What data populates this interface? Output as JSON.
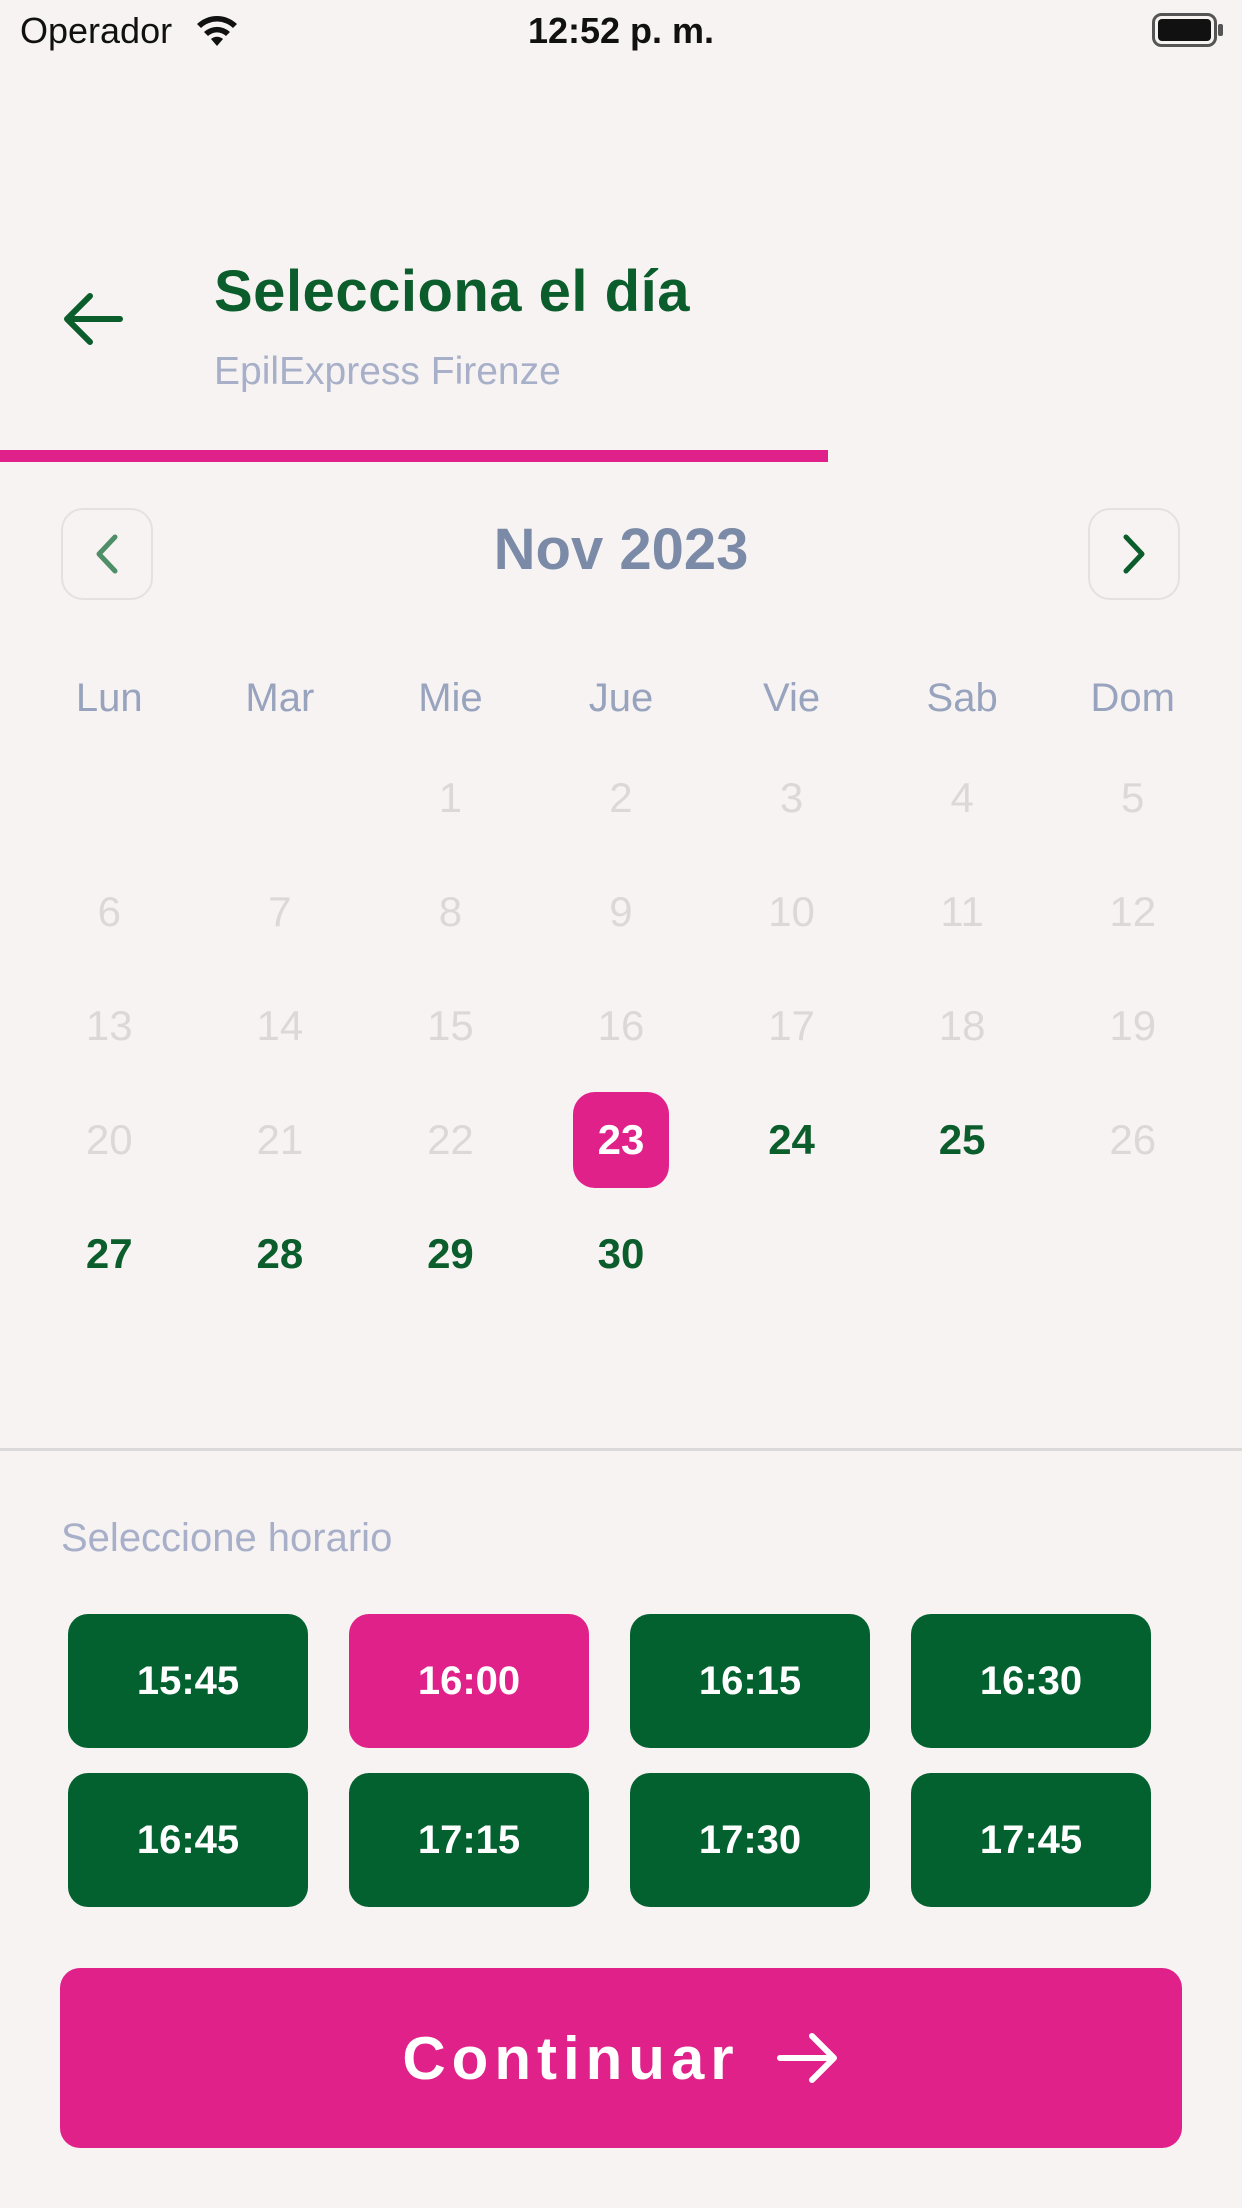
{
  "status_bar": {
    "carrier": "Operador",
    "time": "12:52 p. m."
  },
  "header": {
    "title": "Selecciona el día",
    "subtitle": "EpilExpress Firenze",
    "progress_fraction": 0.667
  },
  "calendar": {
    "month_label": "Nov 2023",
    "weekdays": [
      "Lun",
      "Mar",
      "Mie",
      "Jue",
      "Vie",
      "Sab",
      "Dom"
    ],
    "leading_blanks": 2,
    "days": [
      {
        "label": "1",
        "state": "disabled"
      },
      {
        "label": "2",
        "state": "disabled"
      },
      {
        "label": "3",
        "state": "disabled"
      },
      {
        "label": "4",
        "state": "disabled"
      },
      {
        "label": "5",
        "state": "disabled"
      },
      {
        "label": "6",
        "state": "disabled"
      },
      {
        "label": "7",
        "state": "disabled"
      },
      {
        "label": "8",
        "state": "disabled"
      },
      {
        "label": "9",
        "state": "disabled"
      },
      {
        "label": "10",
        "state": "disabled"
      },
      {
        "label": "11",
        "state": "disabled"
      },
      {
        "label": "12",
        "state": "disabled"
      },
      {
        "label": "13",
        "state": "disabled"
      },
      {
        "label": "14",
        "state": "disabled"
      },
      {
        "label": "15",
        "state": "disabled"
      },
      {
        "label": "16",
        "state": "disabled"
      },
      {
        "label": "17",
        "state": "disabled"
      },
      {
        "label": "18",
        "state": "disabled"
      },
      {
        "label": "19",
        "state": "disabled"
      },
      {
        "label": "20",
        "state": "disabled"
      },
      {
        "label": "21",
        "state": "disabled"
      },
      {
        "label": "22",
        "state": "disabled"
      },
      {
        "label": "23",
        "state": "selected"
      },
      {
        "label": "24",
        "state": "available"
      },
      {
        "label": "25",
        "state": "available"
      },
      {
        "label": "26",
        "state": "disabled"
      },
      {
        "label": "27",
        "state": "available"
      },
      {
        "label": "28",
        "state": "available"
      },
      {
        "label": "29",
        "state": "available"
      },
      {
        "label": "30",
        "state": "available"
      }
    ]
  },
  "schedule": {
    "label": "Seleccione horario",
    "slots": [
      {
        "time": "15:45",
        "selected": false
      },
      {
        "time": "16:00",
        "selected": true
      },
      {
        "time": "16:15",
        "selected": false
      },
      {
        "time": "16:30",
        "selected": false
      },
      {
        "time": "16:45",
        "selected": false
      },
      {
        "time": "17:15",
        "selected": false
      },
      {
        "time": "17:30",
        "selected": false
      },
      {
        "time": "17:45",
        "selected": false
      }
    ]
  },
  "continue_button": {
    "label": "Continuar"
  },
  "colors": {
    "brand_pink": "#e0218a",
    "brand_green": "#0b5d2c",
    "slot_green": "#03612f",
    "muted_text": "#a7b0c8",
    "background": "#f7f3f3"
  },
  "icons": {
    "back": "arrow-left-icon",
    "prev": "chevron-left-icon",
    "next": "chevron-right-icon",
    "continue": "arrow-right-icon",
    "wifi": "wifi-icon",
    "battery": "battery-icon"
  }
}
